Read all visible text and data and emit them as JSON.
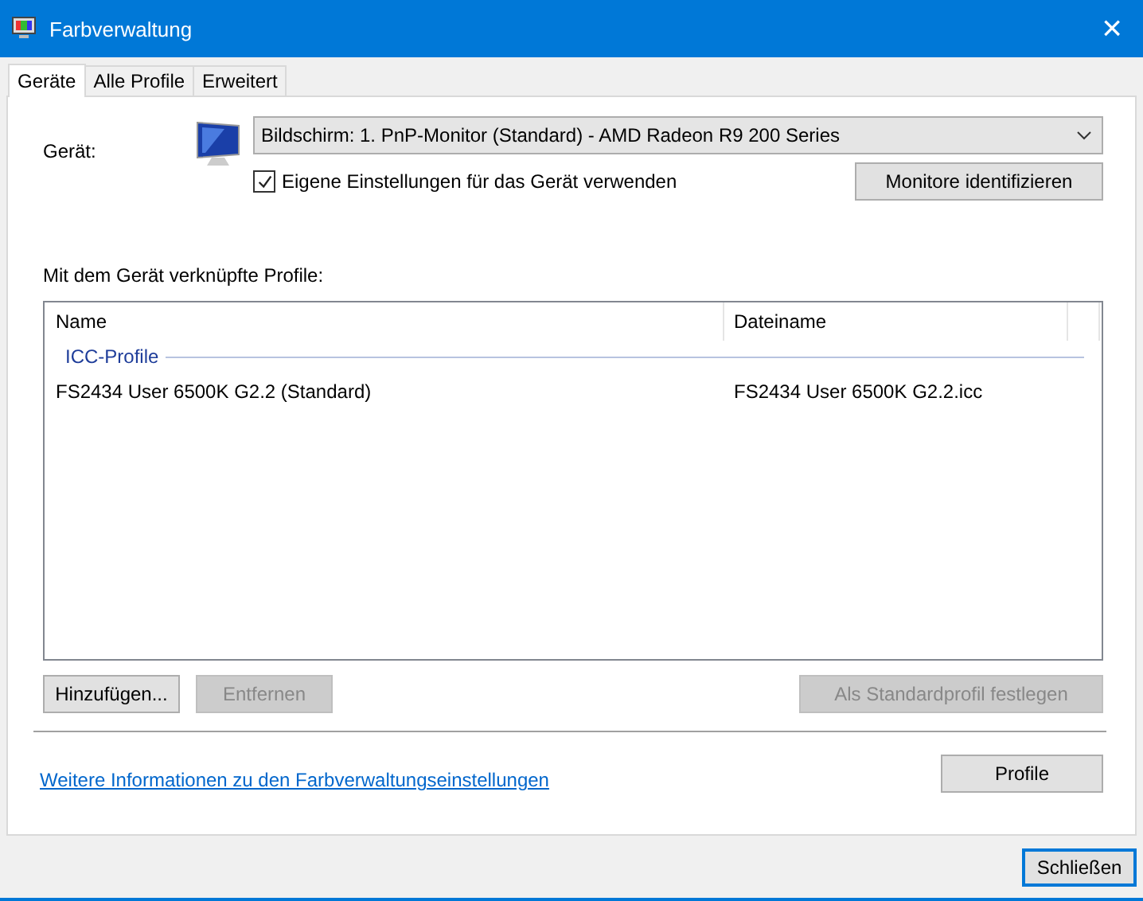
{
  "window": {
    "title": "Farbverwaltung",
    "close": "×"
  },
  "tabs": [
    {
      "label": "Geräte",
      "selected": true
    },
    {
      "label": "Alle Profile",
      "selected": false
    },
    {
      "label": "Erweitert",
      "selected": false
    }
  ],
  "device": {
    "label": "Gerät:",
    "value": "Bildschirm: 1. PnP-Monitor (Standard) - AMD Radeon R9 200 Series",
    "own_settings": {
      "label": "Eigene Einstellungen für das Gerät verwenden",
      "checked": true
    },
    "identify_button": "Monitore identifizieren"
  },
  "profiles": {
    "label": "Mit dem Gerät verknüpfte Profile:",
    "columns": [
      "Name",
      "Dateiname"
    ],
    "groups": [
      {
        "label": "ICC-Profile",
        "rows": [
          {
            "name": "FS2434 User 6500K G2.2 (Standard)",
            "file": "FS2434 User 6500K G2.2.icc"
          }
        ]
      }
    ]
  },
  "profile_buttons": [
    {
      "label": "Hinzufügen...",
      "disabled": false
    },
    {
      "label": "Entfernen",
      "disabled": true
    },
    {
      "label": "Als Standardprofil festlegen",
      "disabled": true
    }
  ],
  "link": "Weitere Informationen zu den Farbverwaltungseinstellungen",
  "profile_button": "Profile",
  "close_button": "Schließen"
}
